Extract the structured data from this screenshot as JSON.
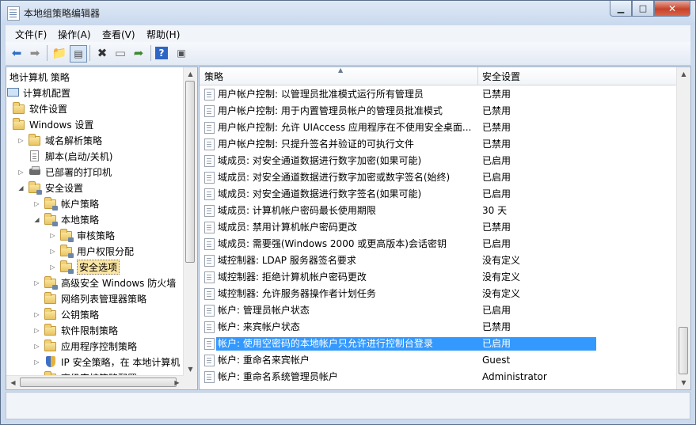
{
  "window": {
    "title": "本地组策略编辑器",
    "controls": {
      "minimize": "▁",
      "maximize": "□",
      "close": "✕"
    }
  },
  "menu": [
    "文件(F)",
    "操作(A)",
    "查看(V)",
    "帮助(H)"
  ],
  "tree": {
    "header": "地计算机 策略",
    "items": [
      {
        "label": "计算机配置",
        "icon": "computer-icon"
      },
      {
        "label": "软件设置",
        "icon": "folder-icon"
      },
      {
        "label": "Windows 设置",
        "icon": "folder-icon"
      },
      {
        "label": "域名解析策略",
        "icon": "folder-icon"
      },
      {
        "label": "脚本(启动/关机)",
        "icon": "script-icon"
      },
      {
        "label": "已部署的打印机",
        "icon": "printer-icon"
      },
      {
        "label": "安全设置",
        "icon": "security-icon"
      },
      {
        "label": "帐户策略",
        "icon": "folder-lock-icon"
      },
      {
        "label": "本地策略",
        "icon": "folder-lock-icon"
      },
      {
        "label": "审核策略",
        "icon": "folder-lock-icon"
      },
      {
        "label": "用户权限分配",
        "icon": "folder-lock-icon"
      },
      {
        "label": "安全选项",
        "icon": "folder-lock-icon"
      },
      {
        "label": "高级安全 Windows 防火墙",
        "icon": "folder-lock-icon"
      },
      {
        "label": "网络列表管理器策略",
        "icon": "folder-icon"
      },
      {
        "label": "公钥策略",
        "icon": "folder-icon"
      },
      {
        "label": "软件限制策略",
        "icon": "folder-icon"
      },
      {
        "label": "应用程序控制策略",
        "icon": "folder-icon"
      },
      {
        "label": "IP 安全策略，在 本地计算机",
        "icon": "ip-security-icon"
      },
      {
        "label": "高级审核策略配置",
        "icon": "folder-icon"
      }
    ]
  },
  "table": {
    "columns": [
      "策略",
      "安全设置"
    ],
    "rows": [
      {
        "policy": "用户帐户控制: 以管理员批准模式运行所有管理员",
        "setting": "已禁用"
      },
      {
        "policy": "用户帐户控制: 用于内置管理员帐户的管理员批准模式",
        "setting": "已禁用"
      },
      {
        "policy": "用户帐户控制: 允许 UIAccess 应用程序在不使用安全桌面...",
        "setting": "已禁用"
      },
      {
        "policy": "用户帐户控制: 只提升签名并验证的可执行文件",
        "setting": "已禁用"
      },
      {
        "policy": "域成员: 对安全通道数据进行数字加密(如果可能)",
        "setting": "已启用"
      },
      {
        "policy": "域成员: 对安全通道数据进行数字加密或数字签名(始终)",
        "setting": "已启用"
      },
      {
        "policy": "域成员: 对安全通道数据进行数字签名(如果可能)",
        "setting": "已启用"
      },
      {
        "policy": "域成员: 计算机帐户密码最长使用期限",
        "setting": "30 天"
      },
      {
        "policy": "域成员: 禁用计算机帐户密码更改",
        "setting": "已禁用"
      },
      {
        "policy": "域成员: 需要强(Windows 2000 或更高版本)会话密钥",
        "setting": "已启用"
      },
      {
        "policy": "域控制器: LDAP 服务器签名要求",
        "setting": "没有定义"
      },
      {
        "policy": "域控制器: 拒绝计算机帐户密码更改",
        "setting": "没有定义"
      },
      {
        "policy": "域控制器: 允许服务器操作者计划任务",
        "setting": "没有定义"
      },
      {
        "policy": "帐户: 管理员帐户状态",
        "setting": "已启用"
      },
      {
        "policy": "帐户: 来宾帐户状态",
        "setting": "已禁用"
      },
      {
        "policy": "帐户: 使用空密码的本地帐户只允许进行控制台登录",
        "setting": "已启用"
      },
      {
        "policy": "帐户: 重命名来宾帐户",
        "setting": "Guest"
      },
      {
        "policy": "帐户: 重命名系统管理员帐户",
        "setting": "Administrator"
      }
    ]
  },
  "colors": {
    "selection": "#3399ff",
    "tree_selection": "#fbe5a3"
  }
}
